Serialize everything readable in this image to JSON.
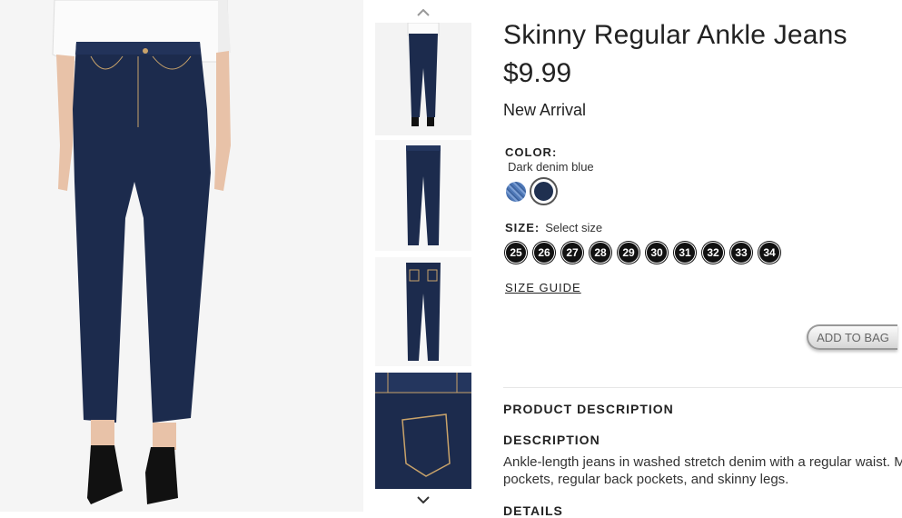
{
  "product": {
    "title": "Skinny Regular Ankle Jeans",
    "price": "$9.99",
    "badge": "New Arrival"
  },
  "color": {
    "label": "COLOR:",
    "selected": "Dark denim blue",
    "swatches": [
      {
        "name": "light-denim",
        "hex": "#5b82c0"
      },
      {
        "name": "dark-denim-blue",
        "hex": "#1f3050"
      }
    ]
  },
  "size": {
    "label": "SIZE:",
    "placeholder": "Select size",
    "options": [
      "25",
      "26",
      "27",
      "28",
      "29",
      "30",
      "31",
      "32",
      "33",
      "34"
    ]
  },
  "size_guide": "SIZE GUIDE",
  "add_to_bag": "ADD TO BAG",
  "description_section": {
    "heading": "PRODUCT DESCRIPTION",
    "sub_heading": "DESCRIPTION",
    "text": "Ankle-length jeans in washed stretch denim with a regular waist. M\npockets, regular back pockets, and skinny legs.",
    "details_heading": "DETAILS"
  },
  "gallery": {
    "up_icon": "chevron-up-icon",
    "down_icon": "chevron-down-icon",
    "thumbnail_count": 4
  },
  "colors": {
    "denim": "#1c2b4d",
    "shirt": "#f7f7f7",
    "background": "#f4f4f4"
  }
}
